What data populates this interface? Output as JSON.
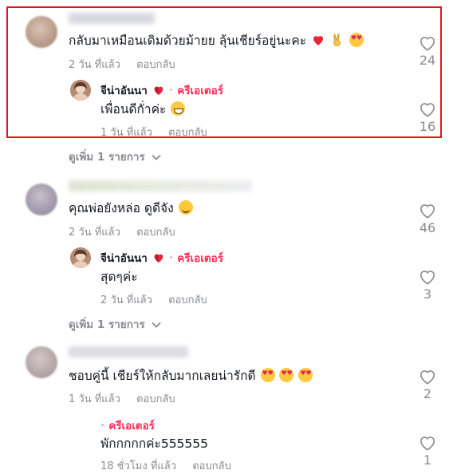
{
  "threads": [
    {
      "comment": {
        "text": "กลับมาเหมือนเดิมด้วยม้ายย ลุ้นเชียร์อยู่นะคะ",
        "emojis": [
          "heart-emoji",
          "victory-hand-emoji",
          "smiling-face-hearts-emoji"
        ],
        "age": "2 วัน ที่แล้ว",
        "reply_label": "ตอบกลับ",
        "likes": "24"
      },
      "reply": {
        "author": "จีน่าอันนา",
        "author_emoji": "heart-emoji",
        "role": "ครีเอเตอร์",
        "text": "เพื่อนดีกั่าค่ะ",
        "emojis": [
          "grinning-face-emoji"
        ],
        "age": "1 วัน ที่แล้ว",
        "reply_label": "ตอบกลับ",
        "likes": "16"
      },
      "more": "ดูเพิ่ม 1 รายการ"
    },
    {
      "comment": {
        "text": "คุณพ่อยังหล่อ ดูดีจัง",
        "emojis": [
          "smiling-face-emoji"
        ],
        "age": "2 วัน ที่แล้ว",
        "reply_label": "ตอบกลับ",
        "likes": "46"
      },
      "reply": {
        "author": "จีน่าอันนา",
        "author_emoji": "heart-emoji",
        "role": "ครีเอเตอร์",
        "text": "สุดๆค่ะ",
        "emojis": [],
        "age": "2 วัน ที่แล้ว",
        "reply_label": "ตอบกลับ",
        "likes": "3"
      },
      "more": "ดูเพิ่ม 1 รายการ"
    },
    {
      "comment": {
        "text": "ชอบคู่นี้ เชียร์ให้กลับมากเลยน่ารักดี",
        "emojis": [
          "smiling-face-hearts-emoji",
          "smiling-face-hearts-emoji",
          "smiling-face-hearts-emoji"
        ],
        "age": "1 วัน ที่แล้ว",
        "reply_label": "ตอบกลับ",
        "likes": "2"
      },
      "reply": {
        "role": "ครีเอเตอร์",
        "text": "พักกกกกค่ะ555555",
        "age": "18 ชั่วโมง ที่แล้ว",
        "reply_label": "ตอบกลับ",
        "likes": "1"
      }
    }
  ],
  "colors": {
    "highlight_border": "#e01818",
    "creator_accent": "#fe2c55",
    "muted_text": "#8a8b91"
  }
}
